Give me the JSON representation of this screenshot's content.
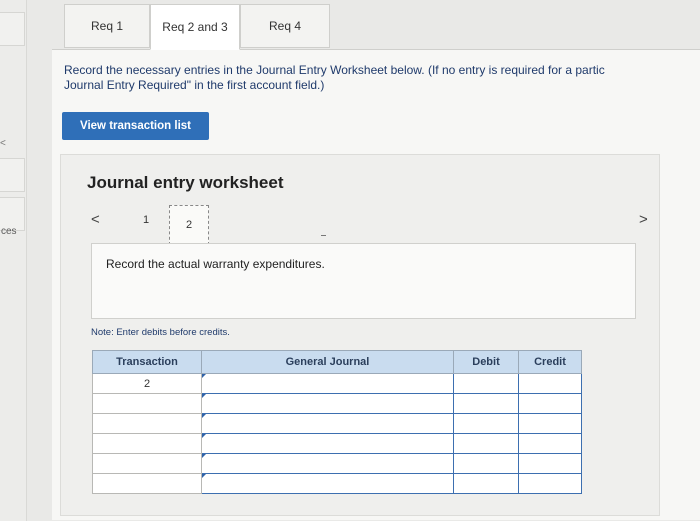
{
  "left_panel": {
    "text": "ces",
    "caret": "<"
  },
  "tabs": [
    {
      "label": "Req 1",
      "active": false
    },
    {
      "label": "Req 2 and 3",
      "active": true
    },
    {
      "label": "Req 4",
      "active": false
    }
  ],
  "instructions": {
    "line1": "Record the necessary entries in the Journal Entry Worksheet below. (If no entry is required for a partic",
    "line2": "Journal Entry Required\" in the first account field.)"
  },
  "view_transaction_list_label": "View transaction list",
  "worksheet": {
    "title": "Journal entry worksheet",
    "prev_icon": "<",
    "next_icon": ">",
    "pages": [
      "1",
      "2"
    ],
    "active_page": "2",
    "description": "Record the actual warranty expenditures.",
    "note": "Note: Enter debits before credits."
  },
  "journal_table": {
    "headers": {
      "transaction": "Transaction",
      "general_journal": "General Journal",
      "debit": "Debit",
      "credit": "Credit"
    },
    "rows": [
      {
        "transaction": "2",
        "account": "",
        "debit": "",
        "credit": ""
      },
      {
        "transaction": "",
        "account": "",
        "debit": "",
        "credit": ""
      },
      {
        "transaction": "",
        "account": "",
        "debit": "",
        "credit": ""
      },
      {
        "transaction": "",
        "account": "",
        "debit": "",
        "credit": ""
      },
      {
        "transaction": "",
        "account": "",
        "debit": "",
        "credit": ""
      },
      {
        "transaction": "",
        "account": "",
        "debit": "",
        "credit": ""
      }
    ]
  },
  "colors": {
    "accent": "#2f6fb8",
    "header_bg": "#c9dcef",
    "cell_border": "#3d6fb0"
  }
}
